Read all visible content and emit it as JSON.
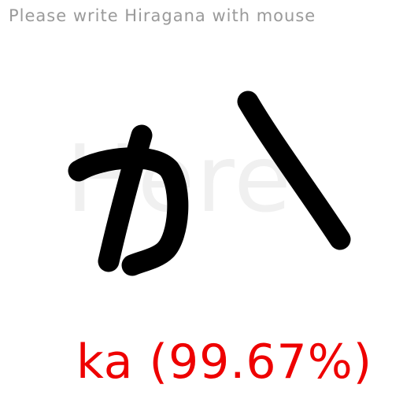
{
  "instruction": "Please write Hiragana with mouse",
  "canvas": {
    "placeholder": "Here",
    "ink_color": "#000000"
  },
  "prediction": {
    "label": "ka",
    "confidence": "99.67%",
    "display": "ka (99.67%)",
    "color": "#ee0000"
  }
}
